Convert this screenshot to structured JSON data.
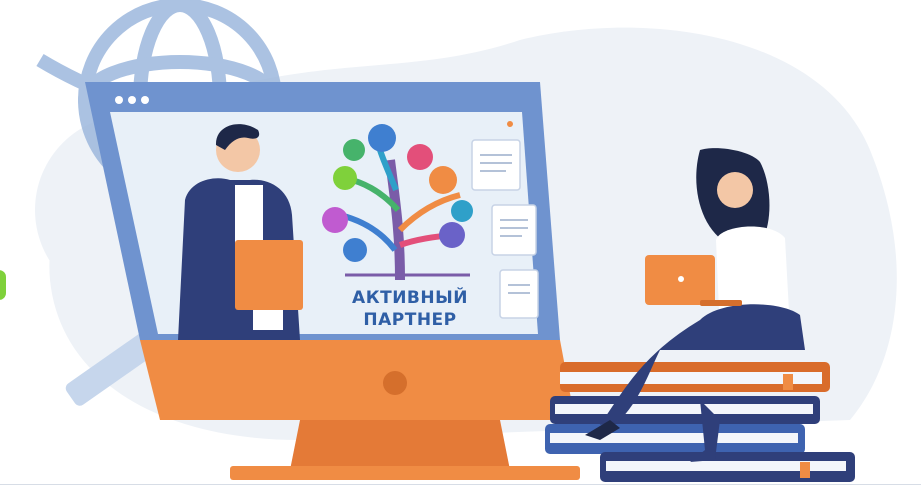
{
  "illustration": {
    "logo": {
      "line1": "АКТИВНЫЙ",
      "line2": "ПАРТНЕР"
    },
    "icons": [
      "tree-logo-icon",
      "laptop-icon",
      "document-icon",
      "globe-icon",
      "magnifier-icon",
      "books-icon"
    ],
    "colors": {
      "monitor_frame": "#6f93cf",
      "monitor_stand": "#ef8a4a",
      "screen_bg": "#e8f0f8",
      "background_blob": "#eef2f7",
      "globe_lines": "#9db8dd",
      "accent_orange": "#f08c44",
      "person_blue": "#2f3f7a"
    }
  }
}
